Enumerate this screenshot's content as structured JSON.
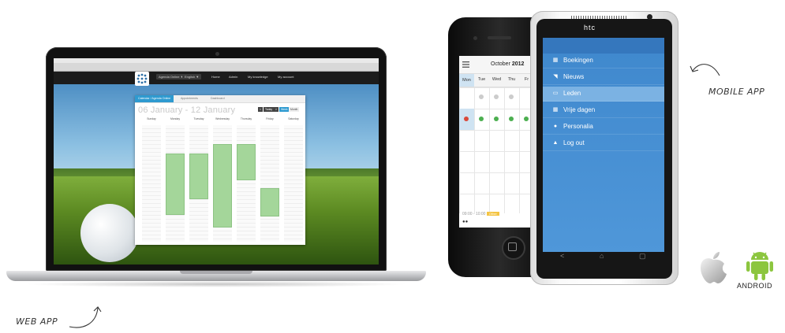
{
  "labels": {
    "web_app": "WEB APP",
    "mobile_app": "MOBILE APP"
  },
  "web": {
    "nav": {
      "agenda_select": "Agenda Online ▼",
      "language_select": "English ▼",
      "home": "Home",
      "admin": "Admin",
      "knowledge": "My knowledge",
      "account": "My account"
    },
    "tabs": [
      "Calendar / Agenda Online",
      "Appointments",
      "Dashboard"
    ],
    "title": "06 January - 12 January",
    "buttons": {
      "prev": "<",
      "today": "Today",
      "next": ">",
      "week": "Week",
      "month": "Month"
    },
    "days": [
      "Sunday",
      "Monday",
      "Tuesday",
      "Wednesday",
      "Thursday",
      "Friday",
      "Saturday"
    ]
  },
  "iphone": {
    "month_label": "October",
    "year_label": "2012",
    "days": [
      "Mon",
      "Tue",
      "Wed",
      "Thu",
      "Fr"
    ],
    "event_time": "09:00 - 10:00",
    "event_tag": "Other"
  },
  "htc": {
    "brand": "htc",
    "menu": [
      {
        "icon": "calendar-icon",
        "glyph": "▦",
        "label": "Boekingen"
      },
      {
        "icon": "rss-icon",
        "glyph": "◥",
        "label": "Nieuws"
      },
      {
        "icon": "book-icon",
        "glyph": "▭",
        "label": "Leden",
        "selected": true
      },
      {
        "icon": "calendar-icon",
        "glyph": "▦",
        "label": "Vrije dagen"
      },
      {
        "icon": "person-icon",
        "glyph": "●",
        "label": "Personalia"
      },
      {
        "icon": "lock-icon",
        "glyph": "▲",
        "label": "Log out"
      }
    ],
    "nav": {
      "back": "<",
      "home": "⌂",
      "recent": "▢"
    }
  },
  "logos": {
    "android_word": "ANDROID"
  },
  "colors": {
    "accent_blue": "#2e9ad0",
    "appointment_green": "#a4d69a",
    "htc_menu_blue": "#4f97d9",
    "htc_selected": "#7bb2e3"
  }
}
